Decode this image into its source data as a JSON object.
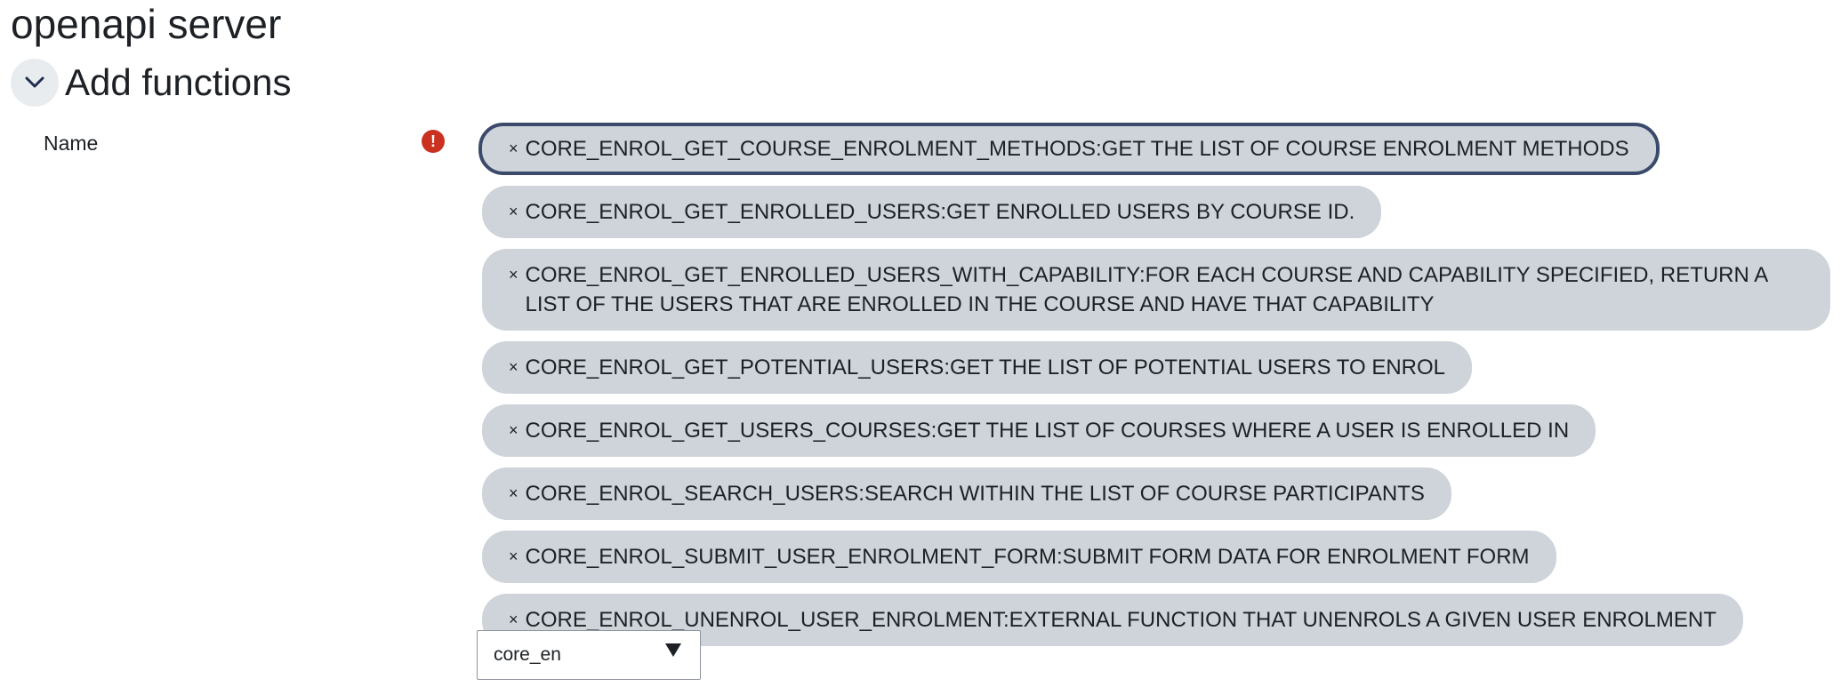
{
  "page": {
    "title": "openapi server"
  },
  "section": {
    "title": "Add functions",
    "toggle_icon": "chevron-down-icon"
  },
  "field": {
    "label": "Name",
    "error_icon_text": "!"
  },
  "chips": [
    {
      "remove": "×",
      "text": "CORE_ENROL_GET_COURSE_ENROLMENT_METHODS:GET THE LIST OF COURSE ENROLMENT METHODS"
    },
    {
      "remove": "×",
      "text": "CORE_ENROL_GET_ENROLLED_USERS:GET ENROLLED USERS BY COURSE ID."
    },
    {
      "remove": "×",
      "text": "CORE_ENROL_GET_ENROLLED_USERS_WITH_CAPABILITY:FOR EACH COURSE AND CAPABILITY SPECIFIED, RETURN A LIST OF THE USERS THAT ARE ENROLLED IN THE COURSE AND HAVE THAT CAPABILITY"
    },
    {
      "remove": "×",
      "text": "CORE_ENROL_GET_POTENTIAL_USERS:GET THE LIST OF POTENTIAL USERS TO ENROL"
    },
    {
      "remove": "×",
      "text": "CORE_ENROL_GET_USERS_COURSES:GET THE LIST OF COURSES WHERE A USER IS ENROLLED IN"
    },
    {
      "remove": "×",
      "text": "CORE_ENROL_SEARCH_USERS:SEARCH WITHIN THE LIST OF COURSE PARTICIPANTS"
    },
    {
      "remove": "×",
      "text": "CORE_ENROL_SUBMIT_USER_ENROLMENT_FORM:SUBMIT FORM DATA FOR ENROLMENT FORM"
    },
    {
      "remove": "×",
      "text": "CORE_ENROL_UNENROL_USER_ENROLMENT:EXTERNAL FUNCTION THAT UNENROLS A GIVEN USER ENROLMENT"
    }
  ],
  "search": {
    "value": "core_en",
    "arrow": "▼"
  },
  "colors": {
    "chip_bg": "#ced4da",
    "focus_border": "#3b4a6b",
    "error": "#ca3120",
    "toggle_bg": "#e9ecef"
  }
}
